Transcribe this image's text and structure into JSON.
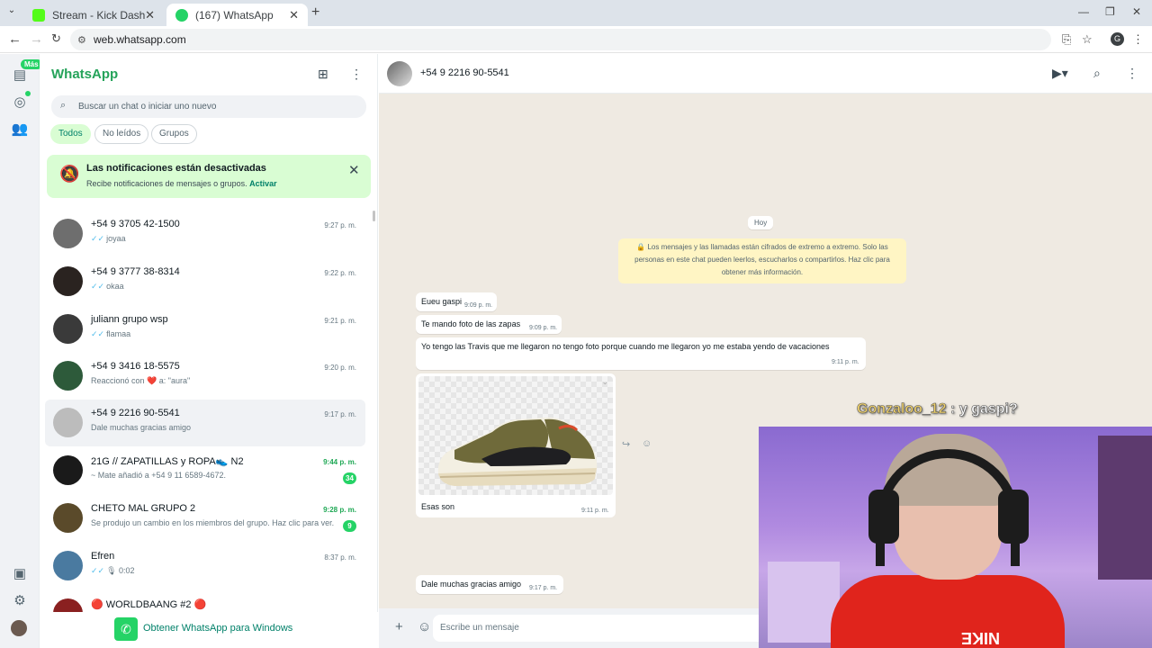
{
  "browser": {
    "tabs": [
      {
        "title": "Stream - Kick Dashboard",
        "favicon_color": "#53fc18"
      },
      {
        "title": "(167) WhatsApp",
        "favicon_color": "#25d366"
      }
    ],
    "url": "web.whatsapp.com",
    "profile_initial": "G"
  },
  "rail": {
    "badge": "Más"
  },
  "sidebar": {
    "title": "WhatsApp",
    "search_placeholder": "Buscar un chat o iniciar uno nuevo",
    "filters": [
      "Todos",
      "No leídos",
      "Grupos"
    ],
    "notification": {
      "title": "Las notificaciones están desactivadas",
      "body": "Recibe notificaciones de mensajes o grupos.",
      "action": "Activar"
    },
    "chats": [
      {
        "name": "+54 9 3705 42-1500",
        "preview": "joyaa",
        "time": "9:27 p. m.",
        "ticks": "✓✓",
        "avatar": "#6e6e6e"
      },
      {
        "name": "+54 9 3777 38-8314",
        "preview": "okaa",
        "time": "9:22 p. m.",
        "ticks": "✓✓",
        "avatar": "#2a2320"
      },
      {
        "name": "juliann grupo wsp",
        "preview": "flamaa",
        "time": "9:21 p. m.",
        "ticks": "✓✓",
        "avatar": "#3a3a3a"
      },
      {
        "name": "+54 9 3416 18-5575",
        "preview": "Reaccionó con ❤️ a: \"aura\"",
        "time": "9:20 p. m.",
        "ticks": "",
        "avatar": "#2d5a3a"
      },
      {
        "name": "+54 9 2216 90-5541",
        "preview": "Dale muchas gracias amigo",
        "time": "9:17 p. m.",
        "ticks": "",
        "avatar": "#bcbcbc"
      },
      {
        "name": "21G // ZAPATILLAS y ROPA👟 N2",
        "preview": "~ Mate añadió a +54 9 11 6589-4672.",
        "time": "9:44 p. m.",
        "ticks": "",
        "avatar": "#1a1a1a",
        "unread": "34"
      },
      {
        "name": "CHETO MAL GRUPO 2",
        "preview": "Se produjo un cambio en los miembros del grupo. Haz clic para ver.",
        "time": "9:28 p. m.",
        "ticks": "",
        "avatar": "#5a4a2a",
        "unread": "9"
      },
      {
        "name": "Efren",
        "preview": "🎙 0:02",
        "time": "8:37 p. m.",
        "ticks": "✓✓",
        "avatar": "#4a7aa0"
      },
      {
        "name": "🔴 WORLDBAANG #2 🔴",
        "preview": "",
        "time": "",
        "ticks": "",
        "avatar": "#8a2020"
      }
    ],
    "get_windows": "Obtener WhatsApp para Windows"
  },
  "conversation": {
    "contact": "+54 9 2216 90-5541",
    "day_chip": "Hoy",
    "encryption_notice": "🔒 Los mensajes y las llamadas están cifrados de extremo a extremo. Solo las personas en este chat pueden leerlos, escucharlos o compartirlos. Haz clic para obtener más información.",
    "messages": [
      {
        "text": "Eueu gaspi",
        "time": "9:09 p. m."
      },
      {
        "text": "Te mando foto de las zapas",
        "time": "9:09 p. m."
      },
      {
        "text": "Yo tengo las Travis que me llegaron no tengo foto porque cuando me llegaron yo me estaba yendo de vacaciones",
        "time": "9:11 p. m."
      },
      {
        "text": "Esas son",
        "time": "9:11 p. m."
      },
      {
        "text": "Dale muchas gracias amigo",
        "time": "9:17 p. m."
      }
    ],
    "composer_placeholder": "Escribe un mensaje"
  },
  "stream_overlay": {
    "chat_user": "Gonzaloo_12",
    "chat_message": ": y gaspi?",
    "shirt_text": "NIKE"
  }
}
